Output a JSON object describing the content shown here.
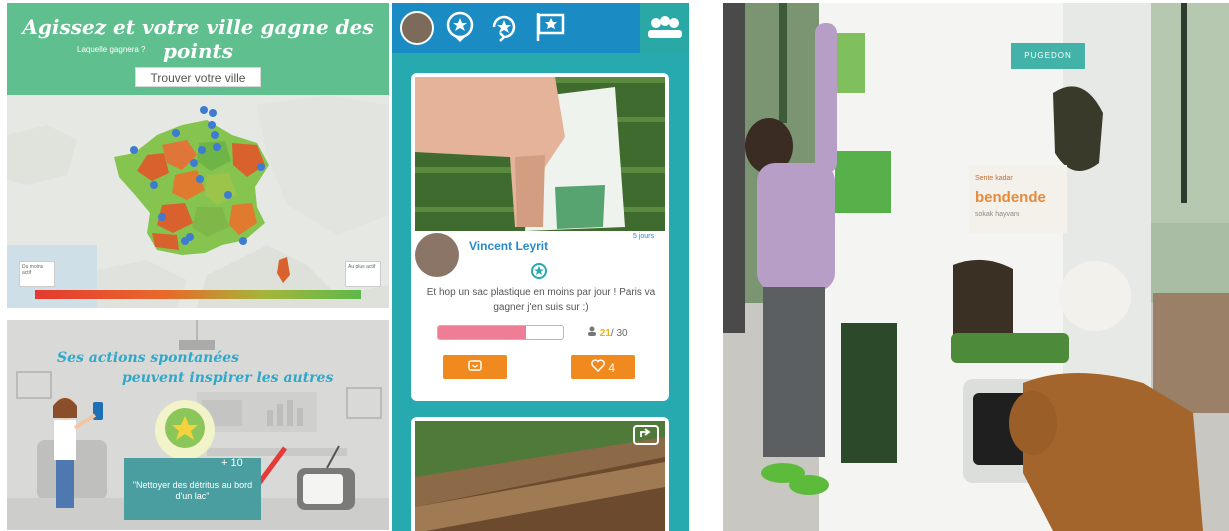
{
  "panel_map": {
    "title": "Agissez et votre ville gagne des points",
    "subtitle": "Laquelle gagnera ?",
    "find_button": "Trouver votre ville",
    "scale_left": "Du moins actif",
    "scale_right": "Au plus actif"
  },
  "panel_inspire": {
    "headline_1": "Ses actions spontanées",
    "headline_2": "peuvent inspirer les autres",
    "points": "+ 10",
    "task_text": "\"Nettoyer des détritus au bord d'un lac\""
  },
  "panel_app": {
    "post": {
      "author": "Vincent Leyrit",
      "time_ago": "5 jours",
      "message": "Et hop un sac plastique en moins par jour ! Paris va gagner j'en suis sur :)",
      "progress_fraction": 0.7,
      "participants_current": "21",
      "participants_total": "/ 30",
      "likes": "4"
    }
  },
  "panel_photo": {
    "brand": "PUGEDON",
    "sign_line_1": "Sente kadar",
    "sign_line_2": "bendende",
    "sign_line_3": "sokak hayvanı"
  },
  "colors": {
    "map_header": "#5fbf8e",
    "app_background": "#26aab0",
    "app_topbar": "#1b8bc4",
    "accent_orange": "#f08a1e",
    "author_blue": "#2a8bc9",
    "progress_pink": "#f07d96",
    "count_yellow": "#ecb21a"
  }
}
